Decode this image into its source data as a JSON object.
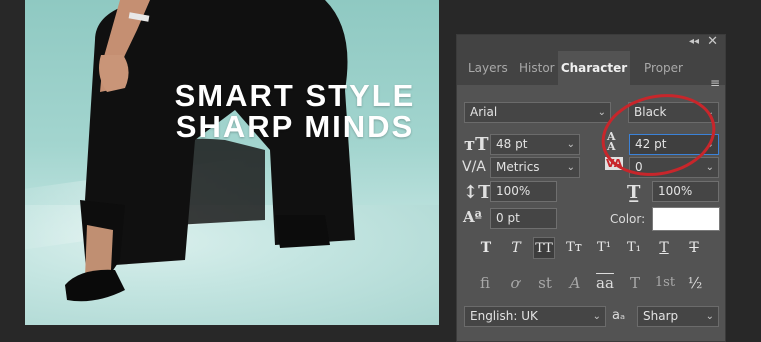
{
  "canvas": {
    "headline_line1": "SMART STYLE",
    "headline_line2": "SHARP MINDS"
  },
  "panel": {
    "tabs": [
      "Layers",
      "Histor",
      "Character",
      "Proper"
    ],
    "active_tab": "Character",
    "font_family": "Arial",
    "font_style": "Black",
    "font_size": "48 pt",
    "leading": "42 pt",
    "kerning": "Metrics",
    "tracking": "0",
    "vertical_scale": "100%",
    "horizontal_scale": "100%",
    "baseline_shift": "0 pt",
    "color_label": "Color:",
    "color_value": "#ffffff",
    "type_buttons": [
      "T",
      "T",
      "TT",
      "Tт",
      "T¹",
      "T₁",
      "T",
      "T"
    ],
    "opentype_buttons": [
      "fi",
      "ơ",
      "st",
      "A",
      "aa",
      "T",
      "1st",
      "½"
    ],
    "language": "English: UK",
    "anti_alias_icon": "aₐ",
    "anti_alias": "Sharp"
  },
  "annotation": {
    "circle_color": "#c8262b"
  }
}
